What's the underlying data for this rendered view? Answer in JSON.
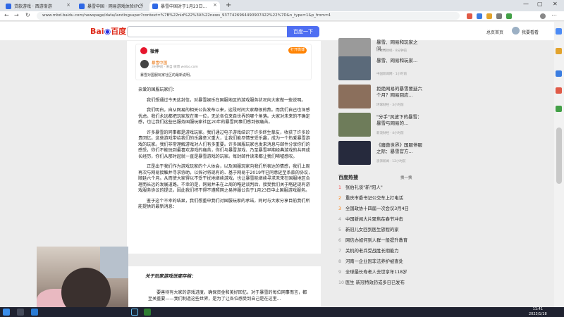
{
  "browser": {
    "tabs": [
      {
        "label": "贷款游戏 · 西游渐游"
      },
      {
        "label": "暴雪中国 · 网易游戏体验(PC)"
      },
      {
        "label": "暴雪中国对于1月23日..."
      }
    ],
    "url": "www.mbd.baidu.com/newspage/data/landingsuper?context=%7B%22nid%22%3A%22news_9377426964490907422%22%7D&n_type=1&p_from=4"
  },
  "baidu": {
    "search_button": "百度一下",
    "header_links": [
      "总页首页",
      "我要看看"
    ]
  },
  "weibo_card": {
    "brand": "微博",
    "open_button": "打开微博",
    "user_name": "暴雪中国",
    "user_meta": "3分钟前 · 来自 微博 weibo.com",
    "summary": "暴雪对国服玩家社区的最新说明。"
  },
  "article": {
    "salutation": "亲爱的国服玩家们：",
    "paragraphs": [
      "我们想通过今天这封信，对暴雪娱乐在国服地区的游戏服务状况向大家做一些说明。",
      "我们明白，自从网易的相关公告发布以来，这段时间大家都很煎熬。而我们自己也深感忧虑。我们永远都把玩家放在第一位，无论各位来自世界的哪个角落。大家对未来的不确定感，也让我们这些已服务国服玩家社区20年的暴雪同事们感到很痛苦。",
      "许多暴雪的同事都是游戏玩家。我们通过电子游戏结识了许多终生挚友，收获了许多珍贵回忆。这些游戏带给我们的乐趣意义重大，让我们能尽情享受乐趣，成为一个热爱暴雪游戏的玩家。我们非常理解游戏对人们有多重要。许多国服玩家也发来消息与邮件分享你们的感受，你们不能玩到最喜欢游戏的痛苦，你们与暴雪游戏、乃至暴雪早期经典游戏的共同成长经历，你们从那时起就一直是暴雪游戏的玩家。每封邮件读来都让我们唏嘘感叹。",
      "正是出于我们作为游戏玩家的个人体会，以及国服玩家向我们所表达的情感，我们上周再次与网易接触并寻求协助，以探讨将现有的、基于网易于2019年已同意延至条款的协议，顺延六个月。从而使大家得以不受干扰地继续游戏，也让暴雪能继续寻求未来在国服地区合理而长远的发展道路。不幸的是，网易并未在上周的略延谈判后，接受我们关于略延现有游戏服务协议的提议。因此我们将不得不遵照网之易停服公告于1月23日中止国服游戏服务。",
      "鉴于这个不幸的结果，我们想重申我们对国服玩家的承诺，同时与大家分享目前我们所能提供的最新消息："
    ],
    "subheading": "关于玩家游戏进度存档：",
    "sub_paragraph": "要善待有大家的游戏进度，确保资金和美好回忆。对于暴雪的每位网事而言，都至关重要——我们制造这些世界，是为了让各位感受到自己是在这里..."
  },
  "right_news": [
    {
      "title": "暴雪、网易和玩家之间...",
      "meta": "环球网财经 · 8分钟前"
    },
    {
      "title": "暴雪、网易和玩家...",
      "meta": "中国新闻网 · 1小时前"
    },
    {
      "title": "拒绝网易的暴雪要延六个月？网易回应...",
      "meta": "环球财经 · 3小时前"
    },
    {
      "title": "\"分手\"风波下的暴雪：暴雪与网易的...",
      "meta": "新浪财经 · 4小时前"
    },
    {
      "title": "《魔兽世界》国服停服之际：暴雪官方...",
      "meta": "澎湃新闻 · 12小时前"
    }
  ],
  "hot": {
    "title": "百度热搜",
    "swap": "换一换",
    "items": [
      "张伯礼谈\"新\"阳人\"",
      "重庆市委书记公交车上打电话",
      "全国政协十四届一次会议3月4日",
      "中国新闻大片聚焦在春节冲击",
      "新冠儿女回到医生旅程的家",
      "网信办如何到人群一般提升教育",
      "关机的老兵受战胜长期能力",
      "河南一企业因非法养护被查处",
      "全球最长寿老人去世享年118岁",
      "医生 新冠特效药或多日已发布"
    ]
  },
  "taskbar": {
    "time": "11:41",
    "date": "2023/1/18"
  }
}
